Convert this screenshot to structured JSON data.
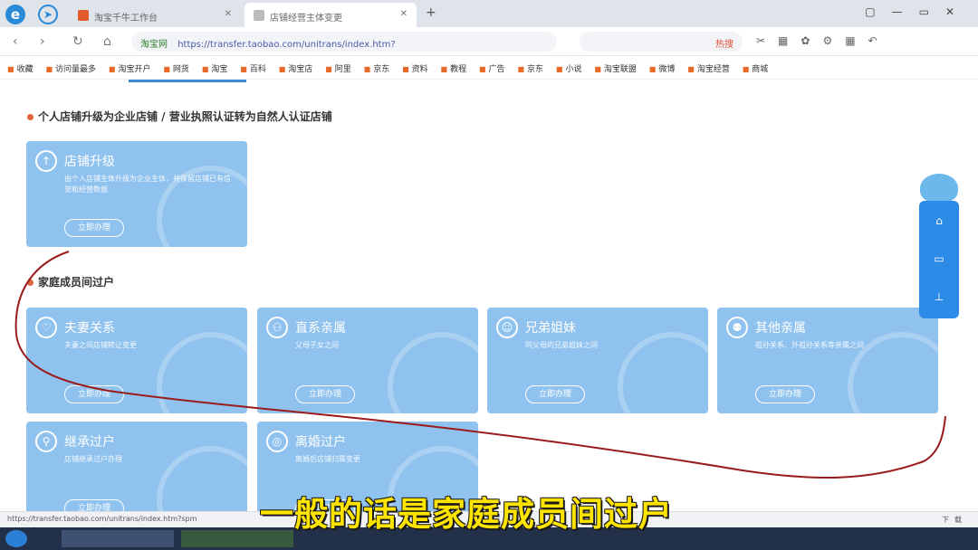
{
  "browser": {
    "tabs": [
      {
        "title": "淘宝千牛工作台"
      },
      {
        "title": "店铺经营主体变更"
      }
    ],
    "address": {
      "site_label": "淘宝网",
      "url": "https://transfer.taobao.com/unitrans/index.htm?"
    },
    "search_hint": "热搜"
  },
  "bookmarks": [
    "收藏",
    "访问量最多",
    "淘宝开户",
    "网货",
    "淘宝",
    "百科",
    "淘宝店",
    "阿里",
    "京东",
    "资料",
    "教程",
    "广告",
    "京东",
    "小说",
    "淘宝联盟",
    "微博",
    "淘宝经营",
    "商城"
  ],
  "page": {
    "section1": {
      "title": "个人店铺升级为企业店铺 / 营业执照认证转为自然人认证店铺"
    },
    "upgrade_card": {
      "title": "店铺升级",
      "desc": "由个人店铺主体升级为企业主体，并保留店铺已有信誉和经营数据",
      "button": "立即办理"
    },
    "section2": {
      "title": "家庭成员间过户"
    },
    "cards": [
      {
        "title": "夫妻关系",
        "desc": "夫妻之间店铺转让变更",
        "button": "立即办理",
        "icon": "heart-icon"
      },
      {
        "title": "直系亲属",
        "desc": "父母子女之间",
        "button": "立即办理",
        "icon": "family-icon"
      },
      {
        "title": "兄弟姐妹",
        "desc": "同父母的兄弟姐妹之间",
        "button": "立即办理",
        "icon": "face-icon"
      },
      {
        "title": "其他亲属",
        "desc": "祖孙关系、外祖孙关系等亲属之间",
        "button": "立即办理",
        "icon": "people-icon"
      },
      {
        "title": "继承过户",
        "desc": "店铺继承过户办理",
        "button": "立即办理",
        "icon": "person-run-icon"
      },
      {
        "title": "离婚过户",
        "desc": "离婚后店铺归属变更",
        "button": "立即办理",
        "icon": "globe-icon"
      }
    ]
  },
  "statusbar": {
    "url": "https://transfer.taobao.com/unitrans/index.htm?spm",
    "right": "下载"
  },
  "subtitle": "一般的话是家庭成员间过户"
}
